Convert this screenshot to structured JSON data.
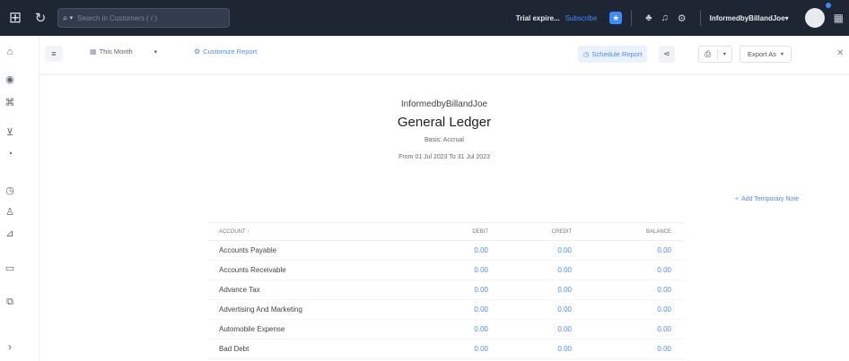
{
  "topbar": {
    "search_placeholder": "Search in Customers ( / )",
    "trial_text": "Trial expire...",
    "subscribe_label": "Subscribe",
    "org_name": "InformedbyBillandJoe",
    "org_chevron": "▾"
  },
  "toolbar": {
    "period_label": "This Month",
    "customize_label": "Customize Report",
    "schedule_label": "Schedule Report",
    "export_label": "Export As"
  },
  "report": {
    "org": "InformedbyBillandJoe",
    "title": "General Ledger",
    "basis": "Basis: Accrual",
    "date_range": "From 01 Jul 2023 To 31 Jul 2023",
    "add_note_label": "Add Temporary Note"
  },
  "table": {
    "headers": {
      "account": "ACCOUNT ↑",
      "debit": "DEBIT",
      "credit": "CREDIT",
      "balance": "BALANCE"
    },
    "rows": [
      {
        "account": "Accounts Payable",
        "debit": "0.00",
        "credit": "0.00",
        "balance": "0.00"
      },
      {
        "account": "Accounts Receivable",
        "debit": "0.00",
        "credit": "0.00",
        "balance": "0.00"
      },
      {
        "account": "Advance Tax",
        "debit": "0.00",
        "credit": "0.00",
        "balance": "0.00"
      },
      {
        "account": "Advertising And Marketing",
        "debit": "0.00",
        "credit": "0.00",
        "balance": "0.00"
      },
      {
        "account": "Automobile Expense",
        "debit": "0.00",
        "credit": "0.00",
        "balance": "0.00"
      },
      {
        "account": "Bad Debt",
        "debit": "0.00",
        "credit": "0.00",
        "balance": "0.00"
      }
    ]
  },
  "colors": {
    "topbar_bg": "#1f2633",
    "accent": "#4d8bf0"
  }
}
